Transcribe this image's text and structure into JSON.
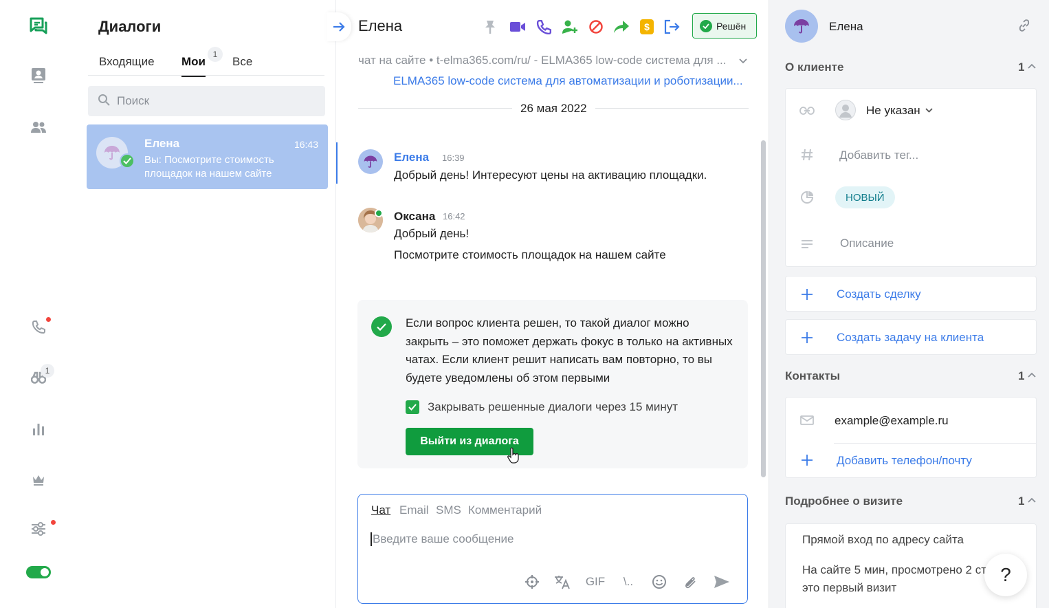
{
  "nav": {
    "badge_count": "1",
    "icons": [
      "chat-icon",
      "contact-card-icon",
      "users-icon",
      "phone-icon",
      "binoculars-icon",
      "bar-chart-icon",
      "crown-icon",
      "sliders-icon",
      "toggle-icon"
    ]
  },
  "list": {
    "title": "Диалоги",
    "tabs": [
      {
        "label": "Входящие"
      },
      {
        "label": "Мои",
        "badge": "1"
      },
      {
        "label": "Все"
      }
    ],
    "search_placeholder": "Поиск",
    "dialogs": [
      {
        "name": "Елена",
        "time": "16:43",
        "preview": "Вы: Посмотрите стоимость площадок на нашем сайте"
      }
    ]
  },
  "chat": {
    "name": "Елена",
    "status_button": "Решён",
    "source": "чат на сайте • t-elma365.com/ru/ - ELMA365 low-code система для ...",
    "source_link": "ELMA365 low-code система для автоматизации и роботизации...",
    "date": "26 мая 2022",
    "messages": [
      {
        "author": "Елена",
        "time": "16:39",
        "lines": [
          "Добрый день! Интересуют цены на активацию площадки."
        ]
      },
      {
        "author": "Оксана",
        "time": "16:42",
        "lines": [
          "Добрый день!",
          "Посмотрите стоимость площадок на нашем сайте"
        ]
      }
    ],
    "notice": {
      "text": "Если вопрос клиента решен, то такой диалог можно закрыть – это поможет держать фокус в только на активных чатах. Если клиент решит написать вам повторно, то вы будете уведомлены об этом первыми",
      "checkbox_label": "Закрывать решенные диалоги через 15 минут",
      "checkbox_checked": true,
      "button": "Выйти из диалога"
    },
    "composer": {
      "tabs": [
        "Чат",
        "Email",
        "SMS",
        "Комментарий"
      ],
      "active_tab": "Чат",
      "placeholder": "Введите ваше сообщение",
      "tool_gif": "GIF",
      "tool_slash": "\\.."
    }
  },
  "client": {
    "name": "Елена",
    "about": {
      "title": "О клиенте",
      "count": "1",
      "owner": "Не указан",
      "tag_placeholder": "Добавить тег...",
      "status": "НОВЫЙ",
      "description_placeholder": "Описание"
    },
    "actions": {
      "create_deal": "Создать сделку",
      "create_task": "Создать задачу на клиента"
    },
    "contacts": {
      "title": "Контакты",
      "count": "1",
      "email": "example@example.ru",
      "add": "Добавить телефон/почту"
    },
    "visit": {
      "title": "Подробнее о визите",
      "count": "1",
      "entry": "Прямой вход по адресу сайта",
      "details": "На сайте 5 мин, просмотрено 2 ст",
      "details2": "это первый визит"
    }
  },
  "help_label": "?",
  "colors": {
    "accent_green": "#22a94a",
    "link_blue": "#3b7be8",
    "selected_item": "#a9c4f0"
  }
}
